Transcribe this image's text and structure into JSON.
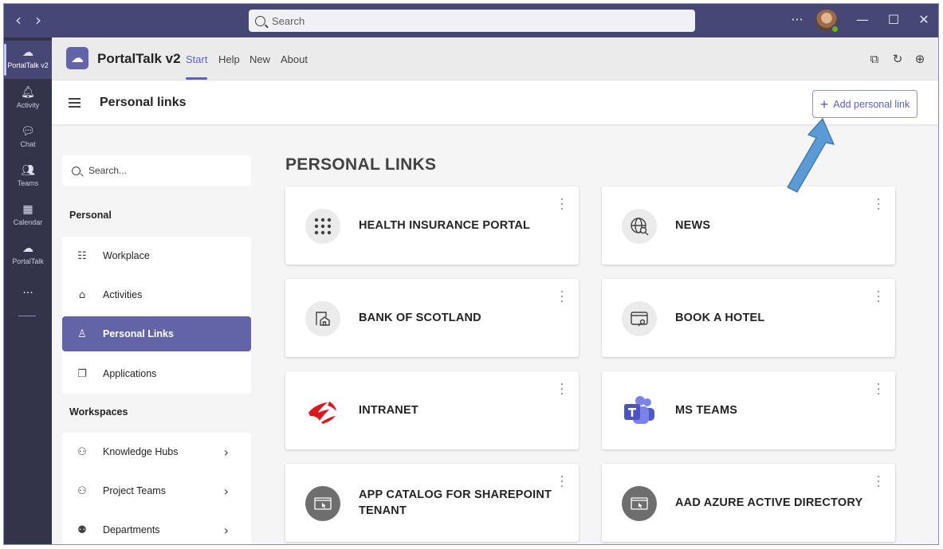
{
  "titlebar": {
    "search_placeholder": "Search",
    "more_glyph": "···"
  },
  "rail": {
    "items": [
      {
        "label": "PortalTalk v2",
        "icon": "portaltalk-icon"
      },
      {
        "label": "Activity",
        "icon": "bell-icon"
      },
      {
        "label": "Chat",
        "icon": "chat-icon"
      },
      {
        "label": "Teams",
        "icon": "teams-icon"
      },
      {
        "label": "Calendar",
        "icon": "calendar-icon"
      },
      {
        "label": "PortalTalk",
        "icon": "cloud-icon"
      }
    ],
    "more_glyph": "···"
  },
  "app": {
    "title": "PortalTalk v2",
    "tabs": [
      "Start",
      "Help",
      "New",
      "About"
    ],
    "active_tab": "Start"
  },
  "pagebar": {
    "title": "Personal links",
    "add_button": "Add personal link"
  },
  "sidebar": {
    "search_placeholder": "Search...",
    "personal_heading": "Personal",
    "personal_items": [
      {
        "label": "Workplace",
        "icon": "list-icon"
      },
      {
        "label": "Activities",
        "icon": "home-icon"
      },
      {
        "label": "Personal Links",
        "icon": "person-icon",
        "active": true
      },
      {
        "label": "Applications",
        "icon": "copy-icon"
      }
    ],
    "workspaces_heading": "Workspaces",
    "workspace_items": [
      {
        "label": "Knowledge Hubs",
        "icon": "teams-icon"
      },
      {
        "label": "Project Teams",
        "icon": "teams-icon"
      },
      {
        "label": "Departments",
        "icon": "people-icon"
      }
    ]
  },
  "content": {
    "title": "PERSONAL LINKS",
    "cards": [
      {
        "label": "HEALTH INSURANCE PORTAL",
        "icon": "app-grid-icon"
      },
      {
        "label": "NEWS",
        "icon": "globe-search-icon"
      },
      {
        "label": "BANK OF SCOTLAND",
        "icon": "building-icon"
      },
      {
        "label": "BOOK A HOTEL",
        "icon": "window-cursor-icon"
      },
      {
        "label": "INTRANET",
        "icon": "rog-logo-icon"
      },
      {
        "label": "MS TEAMS",
        "icon": "ms-teams-logo-icon"
      },
      {
        "label": "APP CATALOG FOR SHAREPOINT TENANT",
        "icon": "browser-cursor-icon"
      },
      {
        "label": "AAD AZURE ACTIVE DIRECTORY",
        "icon": "browser-cursor-icon"
      }
    ]
  },
  "colors": {
    "titlebar": "#464775",
    "rail": "#33344a",
    "accent": "#6264a7",
    "annotation_arrow": "#5b9bd5"
  }
}
